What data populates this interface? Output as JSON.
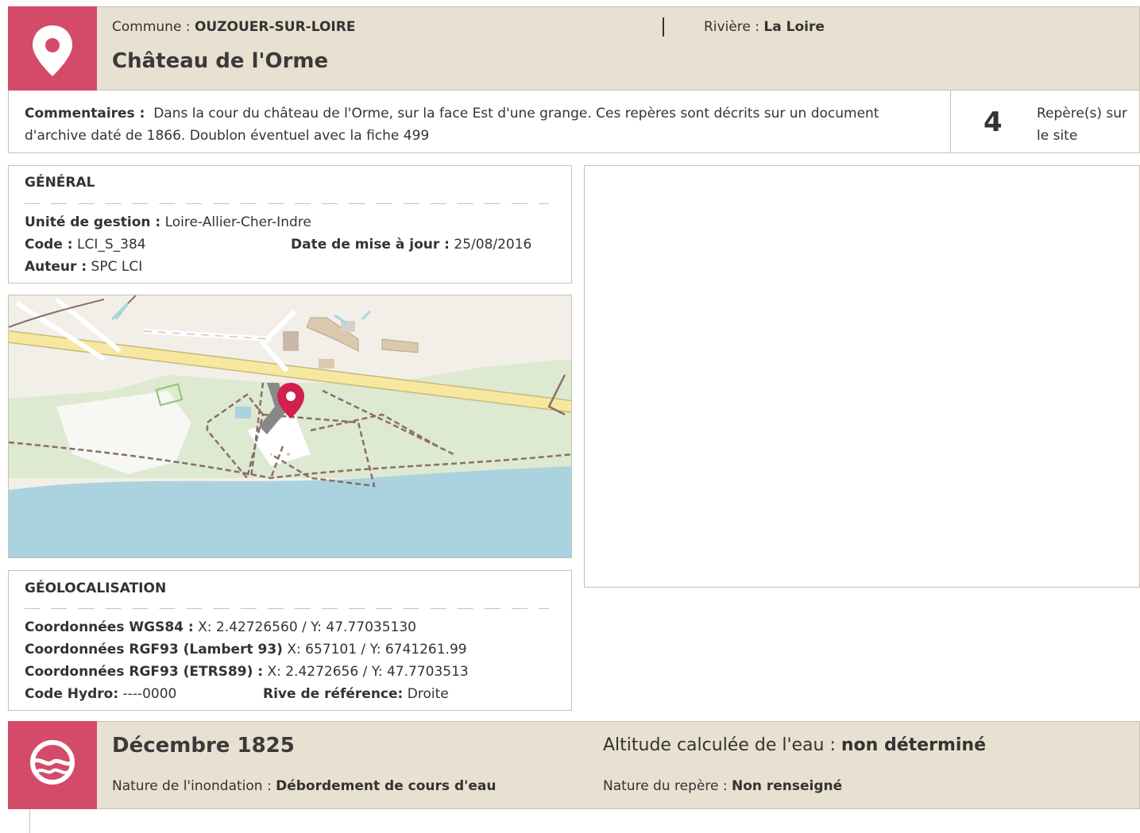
{
  "header": {
    "commune_label": "Commune : ",
    "commune_value": "OUZOUER-SUR-LOIRE",
    "riviere_label": "Rivière : ",
    "riviere_value": "La Loire",
    "site_title": "Château de l'Orme",
    "icon": "map-pin-icon"
  },
  "comments": {
    "label": "Commentaires :",
    "text": "Dans la cour du château de l'Orme, sur la face Est d'une grange. Ces repères sont décrits sur un document d'archive daté de 1866. Doublon éventuel avec la fiche 499",
    "count": "4",
    "count_label": "Repère(s) sur le site"
  },
  "general": {
    "title": "GÉNÉRAL",
    "unite_label": "Unité de gestion :",
    "unite_value": "Loire-Allier-Cher-Indre",
    "code_label": "Code :",
    "code_value": "LCI_S_384",
    "date_label": "Date de mise à jour :",
    "date_value": "25/08/2016",
    "auteur_label": "Auteur :",
    "auteur_value": "SPC LCI"
  },
  "geoloc": {
    "title": "GÉOLOCALISATION",
    "wgs_label": "Coordonnées WGS84 :",
    "wgs_value": "X: 2.42726560 / Y: 47.77035130",
    "lambert_label": "Coordonnées RGF93 (Lambert 93)",
    "lambert_value": "X: 657101 / Y: 6741261.99",
    "etrs_label": "Coordonnées RGF93 (ETRS89) :",
    "etrs_value": "X: 2.4272656 / Y: 47.7703513",
    "hydro_label": "Code Hydro:",
    "hydro_value": "----0000",
    "rive_label": "Rive de référence:",
    "rive_value": "Droite"
  },
  "event": {
    "date": "Décembre 1825",
    "nature_label": "Nature de l'inondation : ",
    "nature_value": "Débordement de cours d'eau",
    "altitude_label": "Altitude calculée de l'eau : ",
    "altitude_value": "non déterminé",
    "repere_label": "Nature du repère : ",
    "repere_value": "Non renseigné",
    "icon": "water-wave-icon"
  },
  "colors": {
    "accent": "#d44b6a",
    "header_bg": "#e8e0d0",
    "border": "#c9c1b2",
    "water": "#aad3df",
    "road": "#f7e8a0"
  }
}
